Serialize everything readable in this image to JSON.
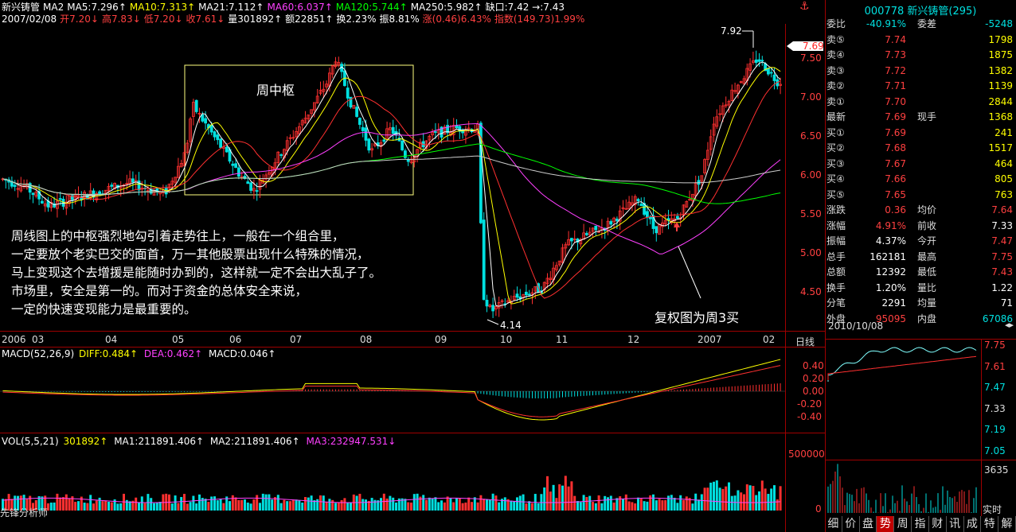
{
  "header": {
    "line1": [
      {
        "text": "新兴铸管",
        "color": "#ffffff"
      },
      {
        "text": "MA2",
        "color": "#ffffff"
      },
      {
        "text": "MA5:7.296↑",
        "color": "#ffffff"
      },
      {
        "text": "MA10:7.313↑",
        "color": "#ffff00"
      },
      {
        "text": "MA21:7.112↑",
        "color": "#ffffff"
      },
      {
        "text": "MA60:6.037↑",
        "color": "#ff40ff"
      },
      {
        "text": "MA120:5.744↑",
        "color": "#00ff00"
      },
      {
        "text": "MA250:5.982↑",
        "color": "#ffffff"
      },
      {
        "text": "缺口:7.42 →:7.43",
        "color": "#ffffff"
      }
    ],
    "line2": [
      {
        "text": "2007/02/08",
        "color": "#ffffff"
      },
      {
        "text": "开7.20↓",
        "color": "#ff4040"
      },
      {
        "text": "高7.83↓",
        "color": "#ff4040"
      },
      {
        "text": "低7.20↓",
        "color": "#ff4040"
      },
      {
        "text": "收7.61↓",
        "color": "#ff4040"
      },
      {
        "text": "量301892↑",
        "color": "#ffffff"
      },
      {
        "text": "额22851↑",
        "color": "#ffffff"
      },
      {
        "text": "换2.23%",
        "color": "#ffffff"
      },
      {
        "text": "振8.81%",
        "color": "#ffffff"
      },
      {
        "text": "涨(0.46)6.43%",
        "color": "#ff4040"
      },
      {
        "text": "指数(149.73)1.99%",
        "color": "#ff4040"
      }
    ]
  },
  "price_axis": [
    "7.50",
    "7.00",
    "6.50",
    "6.00",
    "5.50",
    "5.00",
    "4.50"
  ],
  "current_price_tag": "7.69",
  "high_label": "7.92",
  "low_label": "4.14",
  "box_label": "周中枢",
  "annotation_text": [
    "周线图上的中枢强烈地勾引着走势往上，一般在一个组合里，",
    "一定要放个老实巴交的面首，万一其他股票出现什么特殊的情况，",
    "马上变现这个去增援是能随时办到的，这样就一定不会出大乱子了。",
    "市场里，安全是第一的。而对于资金的总体安全来说，",
    "一定的快速变现能力是最重要的。"
  ],
  "annotation_right": "复权图为周3买",
  "time_axis": [
    "2006",
    "03",
    "04",
    "05",
    "06",
    "07",
    "08",
    "09",
    "10",
    "11",
    "12",
    "2007",
    "02"
  ],
  "time_axis_right": "日线",
  "macd": {
    "label": "MACD(52,26,9)",
    "diff": "DIFF:0.484↑",
    "dea": "DEA:0.462↑",
    "macd": "MACD:0.046↑",
    "axis": [
      "0.40",
      "0.20",
      "0.00",
      "-0.20",
      "-0.40"
    ]
  },
  "vol": {
    "label": "VOL(5,5,21)",
    "v": "301892↑",
    "ma1": "MA1:211891.406↑",
    "ma2": "MA2:211891.406↑",
    "ma3": "MA3:232947.531↓",
    "axis": [
      "500000",
      "0"
    ]
  },
  "footer_label": "先锋分析师",
  "quote": {
    "title": "000778 新兴铸管(295)",
    "weibi_label": "委比",
    "weibi": "-40.91%",
    "weicha_label": "委差",
    "weicha": "-5248",
    "sell": [
      {
        "label": "卖⑤",
        "price": "7.74",
        "vol": "1798"
      },
      {
        "label": "卖④",
        "price": "7.73",
        "vol": "1875"
      },
      {
        "label": "卖③",
        "price": "7.72",
        "vol": "1382"
      },
      {
        "label": "卖②",
        "price": "7.71",
        "vol": "1139"
      },
      {
        "label": "卖①",
        "price": "7.70",
        "vol": "2844"
      }
    ],
    "latest_label": "最新",
    "latest": "7.69",
    "xianshou_label": "现手",
    "xianshou": "1368",
    "buy": [
      {
        "label": "买①",
        "price": "7.69",
        "vol": "241"
      },
      {
        "label": "买②",
        "price": "7.68",
        "vol": "1517"
      },
      {
        "label": "买③",
        "price": "7.67",
        "vol": "464"
      },
      {
        "label": "买④",
        "price": "7.66",
        "vol": "805"
      },
      {
        "label": "买⑤",
        "price": "7.65",
        "vol": "763"
      }
    ],
    "stats": [
      {
        "l1": "涨跌",
        "v1": "0.36",
        "c1": "red",
        "l2": "均价",
        "v2": "7.64",
        "c2": "red"
      },
      {
        "l1": "涨幅",
        "v1": "4.91%",
        "c1": "red",
        "l2": "前收",
        "v2": "7.33",
        "c2": "white"
      },
      {
        "l1": "振幅",
        "v1": "4.37%",
        "c1": "white",
        "l2": "今开",
        "v2": "7.47",
        "c2": "red"
      },
      {
        "l1": "总手",
        "v1": "162181",
        "c1": "white",
        "l2": "最高",
        "v2": "7.75",
        "c2": "red"
      },
      {
        "l1": "总额",
        "v1": "12392",
        "c1": "white",
        "l2": "最低",
        "v2": "7.43",
        "c2": "red"
      },
      {
        "l1": "换手",
        "v1": "1.20%",
        "c1": "white",
        "l2": "量比",
        "v2": "1.22",
        "c2": "white"
      },
      {
        "l1": "分笔",
        "v1": "2291",
        "c1": "white",
        "l2": "均量",
        "v2": "71",
        "c2": "white"
      }
    ],
    "waipan_label": "外盘",
    "waipan": "95095",
    "neipan_label": "内盘",
    "neipan": "67086",
    "date": "2010/10/08",
    "mini_axis": [
      "7.75",
      "7.61",
      "7.47",
      "7.33",
      "7.19",
      "7.05"
    ],
    "mini_vol_axis": [
      "3635"
    ],
    "mini_right": "实时"
  },
  "tabs": [
    "细",
    "价",
    "盘",
    "势",
    "周",
    "指",
    "财",
    "讯",
    "成",
    "特",
    "解"
  ],
  "active_tab": "势"
}
